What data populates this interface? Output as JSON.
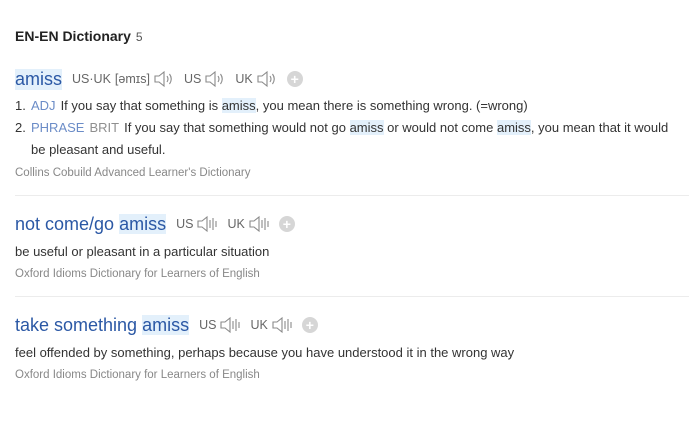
{
  "header": {
    "title": "EN-EN Dictionary",
    "count": "5"
  },
  "entries": [
    {
      "headword": "amiss",
      "pron": [
        {
          "label": "US·UK",
          "ipa": "[əmɪs]"
        },
        {
          "label": "US"
        },
        {
          "label": "UK"
        }
      ],
      "definitions": [
        {
          "num": "1.",
          "pos": "ADJ",
          "pre": "If you say that something is ",
          "hl1": "amiss",
          "mid": ", you mean there is something wrong. (=wrong)"
        },
        {
          "num": "2.",
          "pos": "PHRASE",
          "style": "BRIT",
          "pre": "If you say that something would not go ",
          "hl1": "amiss",
          "mid": " or would not come ",
          "hl2": "amiss",
          "post": ", you mean that it would be pleasant and useful."
        }
      ],
      "source": "Collins Cobuild Advanced Learner's Dictionary"
    },
    {
      "headword_pre": "not come/go ",
      "headword_hl": "amiss",
      "pron": [
        {
          "label": "US"
        },
        {
          "label": "UK"
        }
      ],
      "definition": "be useful or pleasant in a particular situation",
      "source": "Oxford Idioms Dictionary for Learners of English"
    },
    {
      "headword_pre": "take something ",
      "headword_hl": "amiss",
      "pron": [
        {
          "label": "US"
        },
        {
          "label": "UK"
        }
      ],
      "definition": "feel offended by something, perhaps because you have understood it in the wrong way",
      "source": "Oxford Idioms Dictionary for Learners of English"
    }
  ],
  "icons": {
    "speaker": "speaker-icon",
    "add": "plus-icon"
  },
  "colors": {
    "headword": "#2b58a5",
    "highlight": "#e3f0fb",
    "pos": "#6b8cc7"
  }
}
